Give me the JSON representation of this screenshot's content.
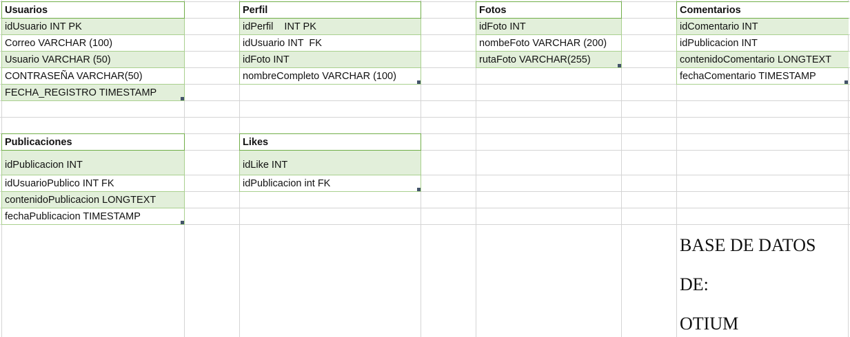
{
  "tables": {
    "usuarios": {
      "title": "Usuarios",
      "fields": [
        "idUsuario INT PK",
        "Correo VARCHAR (100)",
        "Usuario VARCHAR (50)",
        "CONTRASEÑA VARCHAR(50)",
        "FECHA_REGISTRO TIMESTAMP"
      ]
    },
    "perfil": {
      "title": "Perfil",
      "fields": [
        "idPerfil    INT PK",
        "idUsuario INT  FK",
        "idFoto INT",
        "nombreCompleto VARCHAR (100)"
      ]
    },
    "fotos": {
      "title": "Fotos",
      "fields": [
        "idFoto INT",
        "nombeFoto VARCHAR (200)",
        "rutaFoto VARCHAR(255)"
      ]
    },
    "comentarios": {
      "title": "Comentarios",
      "fields": [
        "idComentario INT",
        "idPublicacion INT",
        "contenidoComentario LONGTEXT",
        "fechaComentario TIMESTAMP"
      ]
    },
    "publicaciones": {
      "title": "Publicaciones",
      "fields": [
        "idPublicacion INT",
        "idUsuarioPublico INT FK",
        "contenidoPublicacion LONGTEXT",
        "fechaPublicacion TIMESTAMP"
      ]
    },
    "likes": {
      "title": "Likes",
      "fields": [
        "idLike INT",
        "idPublicacion int FK"
      ]
    }
  },
  "note": {
    "line1": "BASE DE DATOS",
    "line2": "DE:",
    "line3": "OTIUM"
  },
  "colors": {
    "band": "#e2efda",
    "border": "#a9d08e",
    "header_border": "#70ad47",
    "gridline": "#d4d4d4"
  }
}
